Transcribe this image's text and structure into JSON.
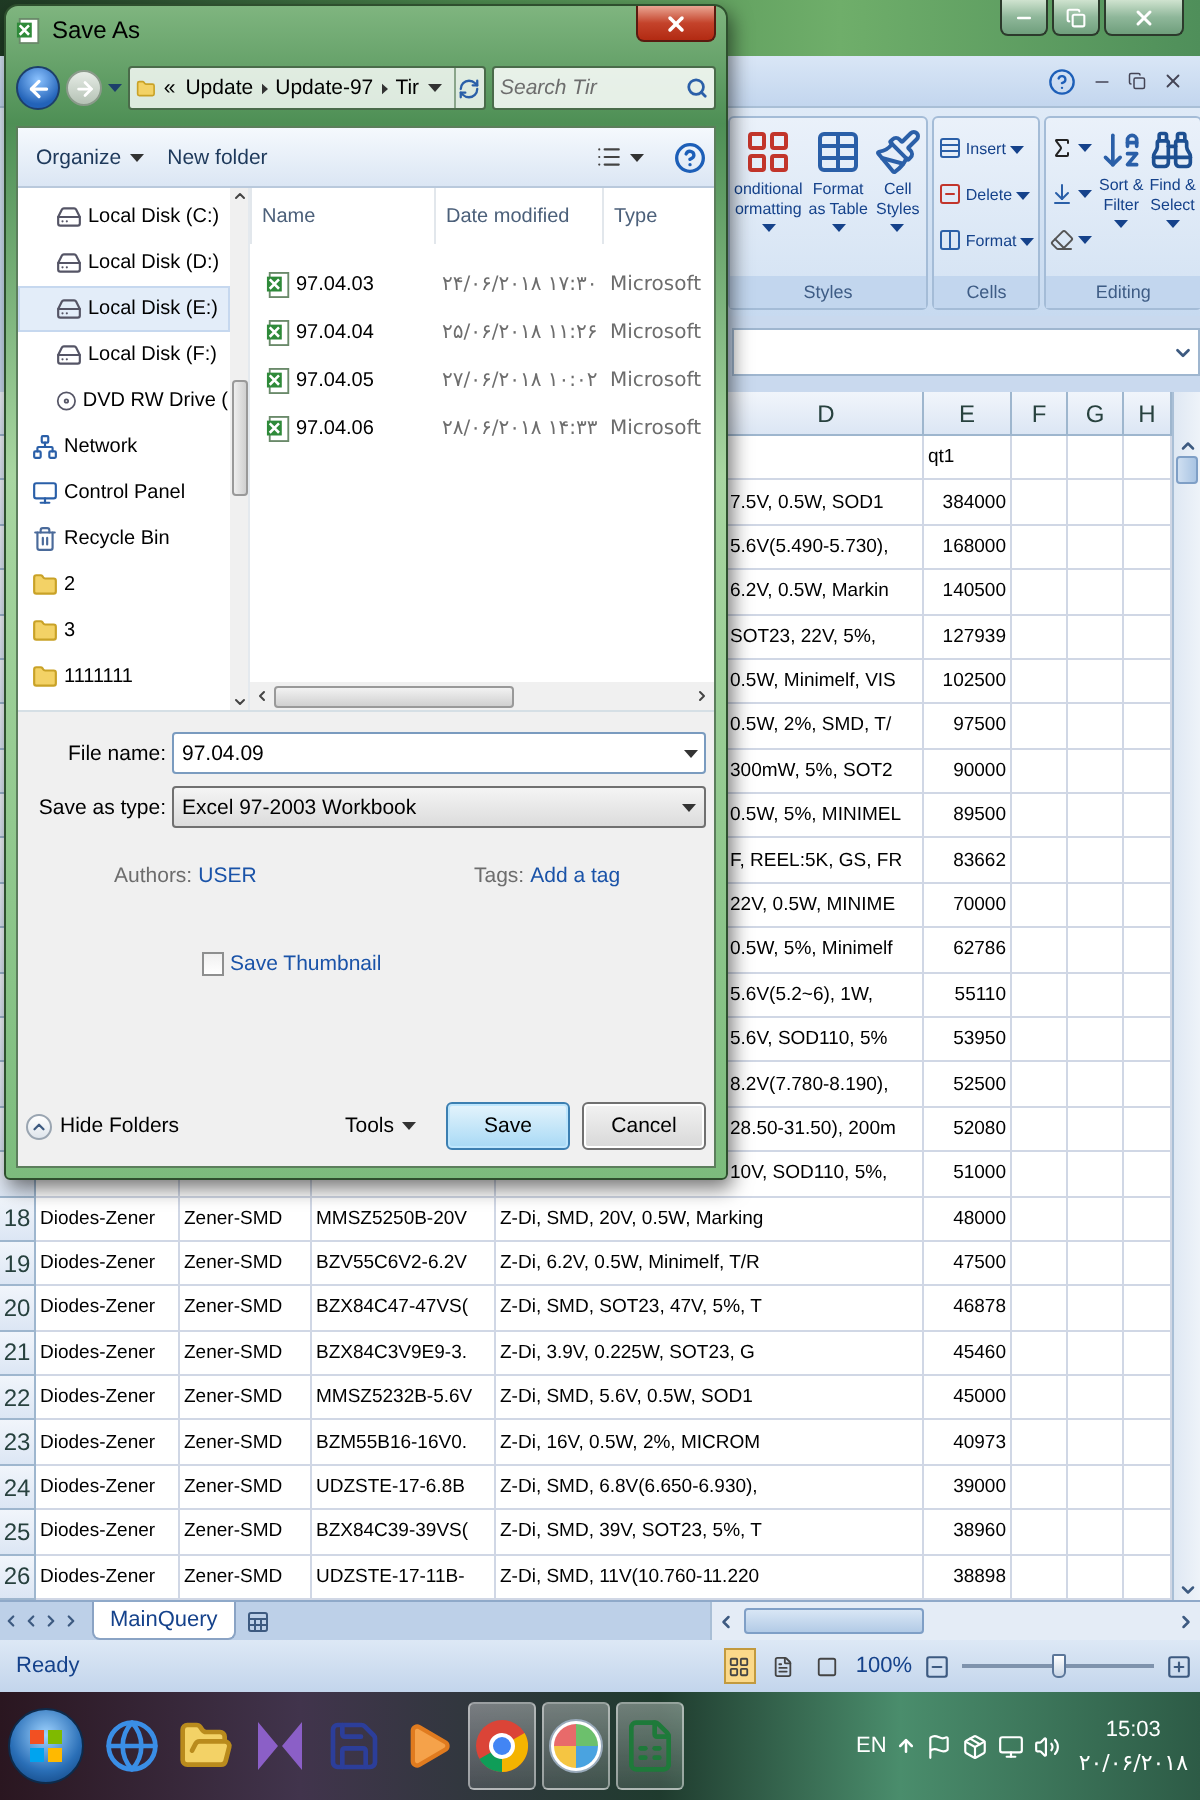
{
  "dialog": {
    "title": "Save As",
    "nav_buttons": [
      {
        "kind": "back",
        "disabled": false
      },
      {
        "kind": "forward",
        "disabled": true
      }
    ],
    "address": {
      "overflow": "«",
      "crumbs": [
        "Update",
        "Update-97",
        "Tir"
      ]
    },
    "search": {
      "placeholder": "Search Tir"
    },
    "toolbar": {
      "organize": "Organize",
      "new_folder": "New folder"
    },
    "nav_items": [
      {
        "label": "Local Disk (C:)",
        "kind": "drive",
        "selected": false
      },
      {
        "label": "Local Disk (D:)",
        "kind": "drive",
        "selected": false
      },
      {
        "label": "Local Disk (E:)",
        "kind": "drive",
        "selected": true
      },
      {
        "label": "Local Disk (F:)",
        "kind": "drive",
        "selected": false
      },
      {
        "label": "DVD RW Drive (",
        "kind": "dvd",
        "selected": false
      },
      {
        "label": "Network",
        "kind": "network",
        "selected": false
      },
      {
        "label": "Control Panel",
        "kind": "control",
        "selected": false
      },
      {
        "label": "Recycle Bin",
        "kind": "bin",
        "selected": false
      },
      {
        "label": "2",
        "kind": "folder",
        "selected": false
      },
      {
        "label": "3",
        "kind": "folder",
        "selected": false
      },
      {
        "label": "1111111",
        "kind": "folder",
        "selected": false
      }
    ],
    "file_columns": [
      "Name",
      "Date modified",
      "Type"
    ],
    "files": [
      {
        "name": "97.04.03",
        "date": "۲۴/۰۶/۲۰۱۸ ۱۷:۳۰",
        "type": "Microsoft"
      },
      {
        "name": "97.04.04",
        "date": "۲۵/۰۶/۲۰۱۸ ۱۱:۲۶",
        "type": "Microsoft"
      },
      {
        "name": "97.04.05",
        "date": "۲۷/۰۶/۲۰۱۸ ۱۰:۰۲",
        "type": "Microsoft"
      },
      {
        "name": "97.04.06",
        "date": "۲۸/۰۶/۲۰۱۸ ۱۴:۳۳",
        "type": "Microsoft"
      }
    ],
    "file_name": {
      "label": "File name:",
      "value": "97.04.09"
    },
    "save_type": {
      "label": "Save as type:",
      "value": "Excel 97-2003 Workbook"
    },
    "authors": {
      "label": "Authors:",
      "value": "USER"
    },
    "tags": {
      "label": "Tags:",
      "value": "Add a tag"
    },
    "thumbnail": {
      "label": "Save Thumbnail",
      "checked": false
    },
    "hide_folders": "Hide Folders",
    "tools": "Tools",
    "buttons": [
      {
        "label": "Save",
        "kind": "default"
      },
      {
        "label": "Cancel",
        "kind": "normal"
      }
    ]
  },
  "ribbon": {
    "groups": [
      {
        "name": "Styles",
        "buttons": [
          {
            "kind": "big",
            "lines": [
              "onditional",
              "ormatting"
            ]
          },
          {
            "kind": "big",
            "lines": [
              "Format",
              "as Table"
            ]
          },
          {
            "kind": "big",
            "lines": [
              "Cell",
              "Styles"
            ]
          }
        ]
      },
      {
        "name": "Cells",
        "buttons": [
          {
            "kind": "small",
            "lines": [
              "Insert"
            ]
          },
          {
            "kind": "small",
            "lines": [
              "Delete"
            ]
          },
          {
            "kind": "small",
            "lines": [
              "Format"
            ]
          }
        ]
      },
      {
        "name": "Editing",
        "buttons": [
          {
            "kind": "icon"
          },
          {
            "kind": "icon"
          },
          {
            "kind": "icon"
          },
          {
            "kind": "big",
            "lines": [
              "Sort &",
              "Filter"
            ]
          },
          {
            "kind": "big",
            "lines": [
              "Find &",
              "Select"
            ]
          }
        ]
      }
    ]
  },
  "sheet": {
    "columns": [
      "D",
      "E",
      "F",
      "G",
      "H"
    ],
    "rows": [
      {
        "kind": "title",
        "cells": [
          "qt1"
        ]
      },
      {
        "kind": "data",
        "cells": [
          "7.5V, 0.5W, SOD1",
          "384000"
        ]
      },
      {
        "kind": "data",
        "cells": [
          "5.6V(5.490-5.730),",
          "168000"
        ]
      },
      {
        "kind": "data",
        "cells": [
          "6.2V, 0.5W, Markin",
          "140500"
        ]
      },
      {
        "kind": "data",
        "cells": [
          "SOT23, 22V, 5%,",
          "127939"
        ]
      },
      {
        "kind": "data",
        "cells": [
          "0.5W, Minimelf, VIS",
          "102500"
        ]
      },
      {
        "kind": "data",
        "cells": [
          "0.5W, 2%, SMD, T/",
          "97500"
        ]
      },
      {
        "kind": "data",
        "cells": [
          "300mW, 5%, SOT2",
          "90000"
        ]
      },
      {
        "kind": "data",
        "cells": [
          "0.5W, 5%, MINIMEL",
          "89500"
        ]
      },
      {
        "kind": "data",
        "cells": [
          "F, REEL:5K, GS, FR",
          "83662"
        ]
      },
      {
        "kind": "data",
        "cells": [
          "22V, 0.5W, MINIME",
          "70000"
        ]
      },
      {
        "kind": "data",
        "cells": [
          "0.5W, 5%, Minimelf",
          "62786"
        ]
      },
      {
        "kind": "data",
        "cells": [
          "5.6V(5.2~6), 1W,",
          "55110"
        ]
      },
      {
        "kind": "data",
        "cells": [
          "5.6V, SOD110, 5%",
          "53950"
        ]
      },
      {
        "kind": "data",
        "cells": [
          "8.2V(7.780-8.190),",
          "52500"
        ]
      },
      {
        "kind": "data",
        "cells": [
          "28.50-31.50), 200m",
          "52080"
        ]
      },
      {
        "kind": "data",
        "cells": [
          "10V, SOD110, 5%,",
          "51000"
        ]
      },
      {
        "kind": "data",
        "number": "18",
        "cells": [
          "Diodes-Zener",
          "Zener-SMD",
          "MMSZ5250B-20V",
          "Z-Di, SMD, 20V, 0.5W, Marking",
          "48000"
        ]
      },
      {
        "kind": "data",
        "number": "19",
        "cells": [
          "Diodes-Zener",
          "Zener-SMD",
          "BZV55C6V2-6.2V",
          "Z-Di, 6.2V, 0.5W, Minimelf, T/R",
          "47500"
        ]
      },
      {
        "kind": "data",
        "number": "20",
        "cells": [
          "Diodes-Zener",
          "Zener-SMD",
          "BZX84C47-47VS(",
          "Z-Di, SMD, SOT23, 47V, 5%, T",
          "46878"
        ]
      },
      {
        "kind": "data",
        "number": "21",
        "cells": [
          "Diodes-Zener",
          "Zener-SMD",
          "BZX84C3V9E9-3.",
          "Z-Di, 3.9V, 0.225W, SOT23, G",
          "45460"
        ]
      },
      {
        "kind": "data",
        "number": "22",
        "cells": [
          "Diodes-Zener",
          "Zener-SMD",
          "MMSZ5232B-5.6V",
          "Z-Di, SMD, 5.6V, 0.5W, SOD1",
          "45000"
        ]
      },
      {
        "kind": "data",
        "number": "23",
        "cells": [
          "Diodes-Zener",
          "Zener-SMD",
          "BZM55B16-16V0.",
          "Z-Di, 16V, 0.5W, 2%, MICROM",
          "40973"
        ]
      },
      {
        "kind": "data",
        "number": "24",
        "cells": [
          "Diodes-Zener",
          "Zener-SMD",
          "UDZSTE-17-6.8B",
          "Z-Di, SMD, 6.8V(6.650-6.930),",
          "39000"
        ]
      },
      {
        "kind": "data",
        "number": "25",
        "cells": [
          "Diodes-Zener",
          "Zener-SMD",
          "BZX84C39-39VS(",
          "Z-Di, SMD, 39V, SOT23, 5%, T",
          "38960"
        ]
      },
      {
        "kind": "data",
        "number": "26",
        "cells": [
          "Diodes-Zener",
          "Zener-SMD",
          "UDZSTE-17-11B-",
          "Z-Di, SMD, 11V(10.760-11.220",
          "38898"
        ]
      }
    ],
    "tabs": [
      {
        "label": "MainQuery",
        "selected": true
      }
    ]
  },
  "status": {
    "text": "Ready",
    "views": [
      {
        "selected": true
      },
      {
        "selected": false
      },
      {
        "selected": false
      }
    ],
    "zoom": "100%",
    "zoom_slider": {
      "level": 0.5
    }
  },
  "taskbar": {
    "apps": [
      {
        "kind": "ie",
        "open": false
      },
      {
        "kind": "explorer",
        "open": false
      },
      {
        "kind": "vs",
        "open": false
      },
      {
        "kind": "save",
        "open": false
      },
      {
        "kind": "media",
        "open": false
      },
      {
        "kind": "chrome",
        "open": true
      },
      {
        "kind": "paint",
        "open": true
      },
      {
        "kind": "excel",
        "open": true
      }
    ],
    "language": "EN",
    "time": "15:03",
    "date": "۲۰/۰۶/۲۰۱۸"
  }
}
